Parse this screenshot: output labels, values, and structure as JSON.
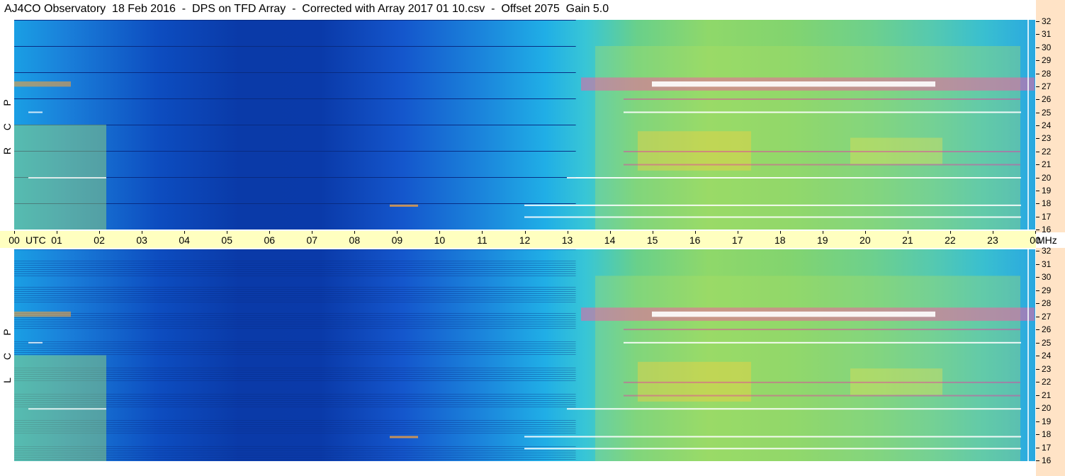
{
  "header": {
    "title": "AJ4CO Observatory  18 Feb 2016  -  DPS on TFD Array  -  Corrected with Array 2017 01 10.csv  -  Offset 2075  Gain 5.0"
  },
  "panels": [
    {
      "id": "rcp",
      "side_label": "R C P"
    },
    {
      "id": "lcp",
      "side_label": "L C P"
    }
  ],
  "time_axis": {
    "unit_label": "UTC",
    "ticks": [
      "00",
      "01",
      "02",
      "03",
      "04",
      "05",
      "06",
      "07",
      "08",
      "09",
      "10",
      "11",
      "12",
      "13",
      "14",
      "15",
      "16",
      "17",
      "18",
      "19",
      "20",
      "21",
      "22",
      "23",
      "00"
    ]
  },
  "freq_axis": {
    "unit_label": "MHz",
    "ticks": [
      "32",
      "31",
      "30",
      "29",
      "28",
      "27",
      "26",
      "25",
      "24",
      "23",
      "22",
      "21",
      "20",
      "19",
      "18",
      "17",
      "16"
    ]
  },
  "chart_data": {
    "type": "heatmap",
    "title": "AJ4CO Observatory  18 Feb 2016  -  DPS on TFD Array  -  Corrected with Array 2017 01 10.csv  -  Offset 2075  Gain 5.0",
    "xlabel": "UTC",
    "ylabel": "MHz",
    "xlim": [
      0,
      24
    ],
    "ylim": [
      16,
      32
    ],
    "x_ticks": [
      "00",
      "01",
      "02",
      "03",
      "04",
      "05",
      "06",
      "07",
      "08",
      "09",
      "10",
      "11",
      "12",
      "13",
      "14",
      "15",
      "16",
      "17",
      "18",
      "19",
      "20",
      "21",
      "22",
      "23",
      "00"
    ],
    "y_ticks": [
      32,
      31,
      30,
      29,
      28,
      27,
      26,
      25,
      24,
      23,
      22,
      21,
      20,
      19,
      18,
      17,
      16
    ],
    "panels": [
      "R C P",
      "L C P"
    ],
    "colormap": [
      "#0a2a90",
      "#1656d0",
      "#1aa4e8",
      "#40d0c8",
      "#90e070",
      "#f0e840",
      "#f06090",
      "#ffffff"
    ]
  }
}
